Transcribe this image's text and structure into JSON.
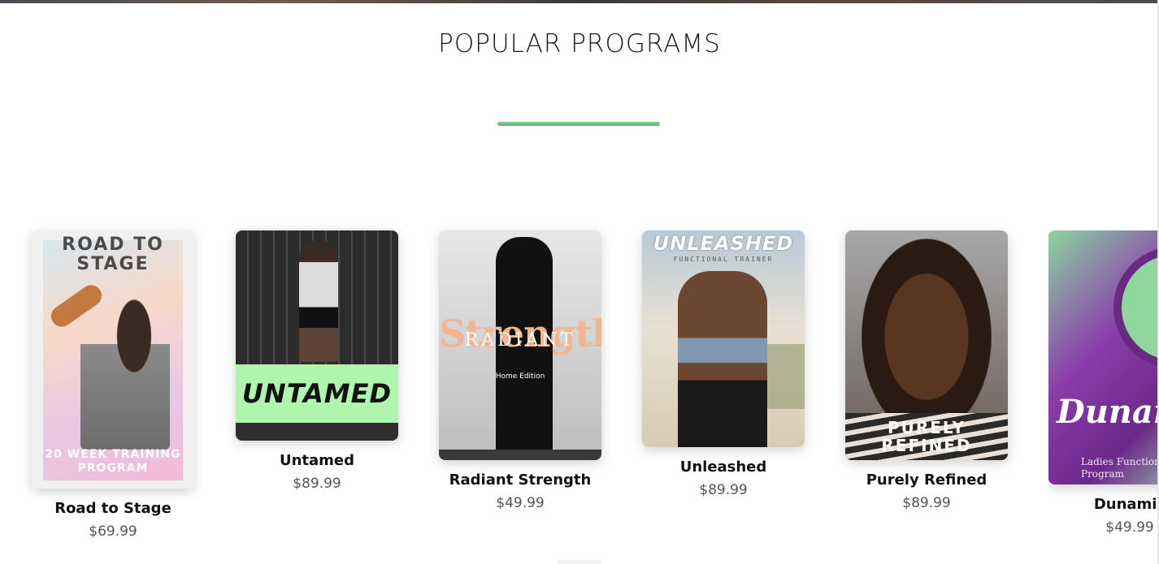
{
  "section": {
    "title": "POPULAR PROGRAMS",
    "accent_color": "#7cc98a"
  },
  "programs": [
    {
      "name": "Road to Stage",
      "price": "$69.99",
      "cover_text": {
        "heading": "ROAD TO STAGE",
        "footer": "20 WEEK TRAINING PROGRAM"
      }
    },
    {
      "name": "Untamed",
      "price": "$89.99",
      "cover_text": {
        "heading": "UNTAMED"
      }
    },
    {
      "name": "Radiant Strength",
      "price": "$49.99",
      "cover_text": {
        "main": "Strength",
        "overlay": "RADIANT",
        "sub": "Home Edition"
      }
    },
    {
      "name": "Unleashed",
      "price": "$89.99",
      "cover_text": {
        "heading": "UNLEASHED",
        "sub": "FUNCTIONAL TRAINER"
      }
    },
    {
      "name": "Purely Refined",
      "price": "$89.99",
      "cover_text": {
        "heading": "PURELY REFINED"
      }
    },
    {
      "name": "Dunamis",
      "price": "$49.99",
      "cover_text": {
        "heading": "Dunamis",
        "sub": "Ladies Functional Training Program"
      }
    }
  ]
}
